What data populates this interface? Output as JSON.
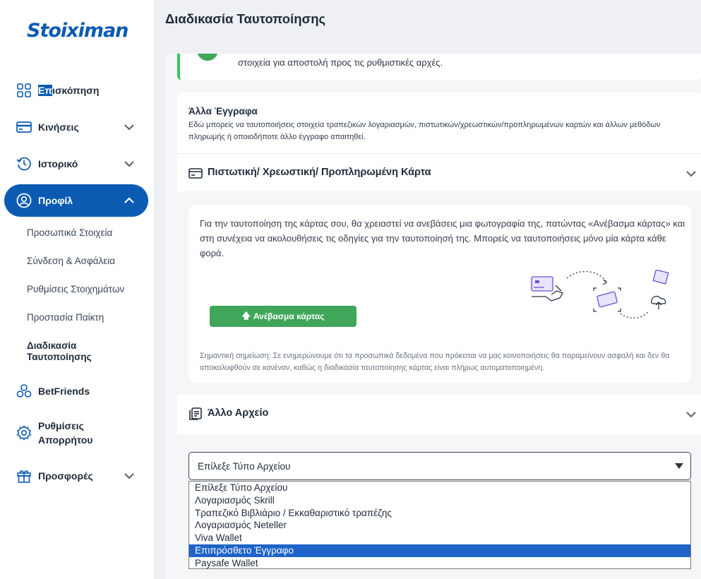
{
  "brand": {
    "logo": "Stoiximan",
    "accent": "#0c5bb3",
    "success": "#3fa65a"
  },
  "sidebar": {
    "items": [
      {
        "label_hl": "Επ",
        "label_rest": "ισκόπηση",
        "icon": "grid-icon"
      },
      {
        "label": "Κινήσεις",
        "icon": "card-icon"
      },
      {
        "label": "Ιστορικό",
        "icon": "history-icon"
      },
      {
        "label": "Προφίλ",
        "icon": "user-icon"
      },
      {
        "label": "BetFriends",
        "icon": "friends-icon"
      },
      {
        "label_line1": "Ρυθμίσεις",
        "label_line2": "Απορρήτου",
        "icon": "gear-icon"
      },
      {
        "label": "Προσφορές",
        "icon": "gift-icon"
      }
    ],
    "profile_sub": [
      "Προσωπικά Στοιχεία",
      "Σύνδεση & Ασφάλεια",
      "Ρυθμίσεις Στοιχημάτων",
      "Προστασία Παίκτη"
    ],
    "current_sub_line1": "Διαδικασία",
    "current_sub_line2": "Ταυτοποίησης"
  },
  "header": {
    "title": "Διαδικασία Ταυτοποίησης"
  },
  "success_note": {
    "text": "στοιχεία για αποστολή προς τις ρυθμιστικές αρχές."
  },
  "other_docs": {
    "title": "Άλλα Έγγραφα",
    "description": "Εδώ μπορείς να ταυτοποιήσεις στοιχεία τραπεζικών λογαριασμών, πιστωτικών/χρεωστικών/προπληρωμένων καρτών και άλλων μεθόδων πληρωμής ή οποιοδήποτε άλλο έγγραφο απαιτηθεί."
  },
  "card_section": {
    "title": "Πιστωτική/ Χρεωστική/ Προπληρωμένη Κάρτα",
    "description": "Για την ταυτοποίηση της κάρτας σου, θα χρειαστεί να ανεβάσεις μια φωτογραφία της, πατώντας «Ανέβασμα κάρτας» και στη συνέχεια να ακολουθήσεις τις οδηγίες για την ταυτοποίησή της. Μπορείς να ταυτοποιήσεις μόνο μία κάρτα κάθε φορά.",
    "upload_button": "Ανέβασμα κάρτας",
    "note": "Σημαντική σημείωση: Σε ενημερώνουμε ότι τα προσωπικά δεδομένα που πρόκειται να μας κοινοποιήσεις θα παραμείνουν ασφαλή και δεν θα αποκαλυφθούν σε κανέναν, καθώς η διαδικασία ταυτοποίησης κάρτας είναι πλήρως αυτοματοποιημένη."
  },
  "file_section": {
    "title": "Άλλο Αρχείο",
    "select_value": "Επίλεξε Τύπο Αρχείου",
    "options": [
      "Επίλεξε Τύπο Αρχείου",
      "Λογαριασμός Skrill",
      "Τραπεζικό Βιβλιάριο / Εκκαθαριστικό τραπέζης",
      "Λογαριασμός Neteller",
      "Viva Wallet",
      "Επιπρόσθετο Έγγραφο",
      "Paysafe Wallet"
    ],
    "highlighted_option": "Επιπρόσθετο Έγγραφο"
  }
}
